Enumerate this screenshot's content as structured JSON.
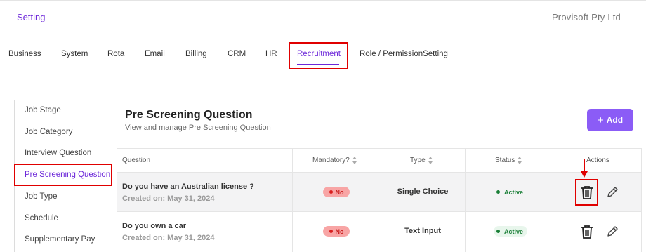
{
  "header": {
    "title": "Setting",
    "company": "Provisoft Pty Ltd"
  },
  "tabs": [
    {
      "label": "Business"
    },
    {
      "label": "System"
    },
    {
      "label": "Rota"
    },
    {
      "label": "Email"
    },
    {
      "label": "Billing"
    },
    {
      "label": "CRM"
    },
    {
      "label": "HR"
    },
    {
      "label": "Recruitment",
      "active": true
    },
    {
      "label": "Role / PermissionSetting"
    }
  ],
  "sidebar": {
    "items": [
      {
        "label": "Job Stage"
      },
      {
        "label": "Job Category"
      },
      {
        "label": "Interview Question"
      },
      {
        "label": "Pre Screening Question",
        "active": true
      },
      {
        "label": "Job Type"
      },
      {
        "label": "Schedule"
      },
      {
        "label": "Supplementary Pay"
      }
    ]
  },
  "main": {
    "title": "Pre Screening Question",
    "subtitle": "View and manage Pre Screening Question",
    "add_label": "Add",
    "add_icon": "plus-icon"
  },
  "table": {
    "columns": {
      "question": "Question",
      "mandatory": "Mandatory?",
      "type": "Type",
      "status": "Status",
      "actions": "Actions"
    },
    "rows": [
      {
        "question": "Do you have an Australian license ?",
        "created": "Created on: May 31, 2024",
        "mandatory": "No",
        "type": "Single Choice",
        "status": "Active"
      },
      {
        "question": "Do you own a car",
        "created": "Created on: May 31, 2024",
        "mandatory": "No",
        "type": "Text Input",
        "status": "Active"
      }
    ],
    "action_icons": [
      "trash-icon",
      "pencil-icon"
    ]
  },
  "colors": {
    "accent": "#6d28d9",
    "button": "#8b5cf6",
    "highlight": "#e00000",
    "danger_pill": "#f8a5a5",
    "active_green": "#1a7f37"
  }
}
